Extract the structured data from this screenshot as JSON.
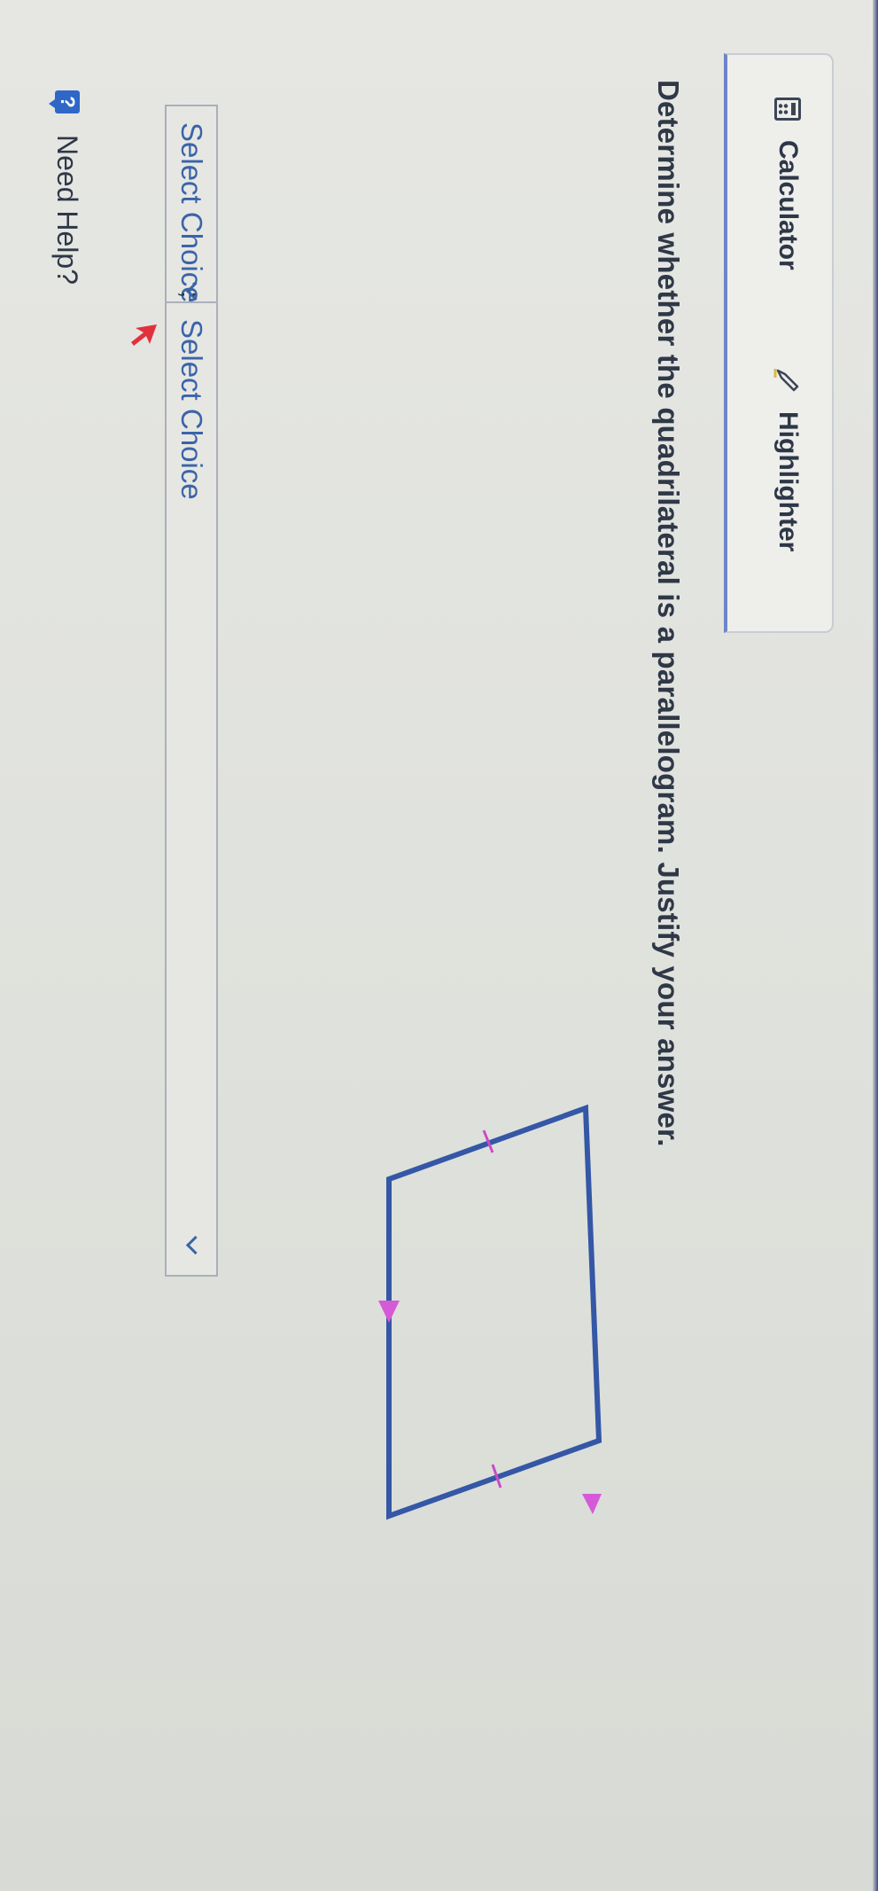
{
  "toolbar": {
    "calculator_label": "Calculator",
    "calculator_icon": "calculator-icon",
    "highlighter_label": "Highlighter",
    "highlighter_icon": "highlighter-icon"
  },
  "question": {
    "text": "Determine whether the quadrilateral is a parallelogram. Justify your answer."
  },
  "answer": {
    "select_1": {
      "value": "Select Choice",
      "icon": "chevron-down-icon"
    },
    "separator": ";",
    "select_2": {
      "value": "Select Choice",
      "icon": "chevron-down-icon"
    }
  },
  "help": {
    "badge": "?",
    "label": "Need Help?"
  },
  "figure": {
    "shape": "quadrilateral",
    "side_color": "#3457a6",
    "parallel_marker_color": "#d45ad8",
    "congruent_tick_color": "#c94bc8",
    "cursor_color": "#e2303c"
  }
}
